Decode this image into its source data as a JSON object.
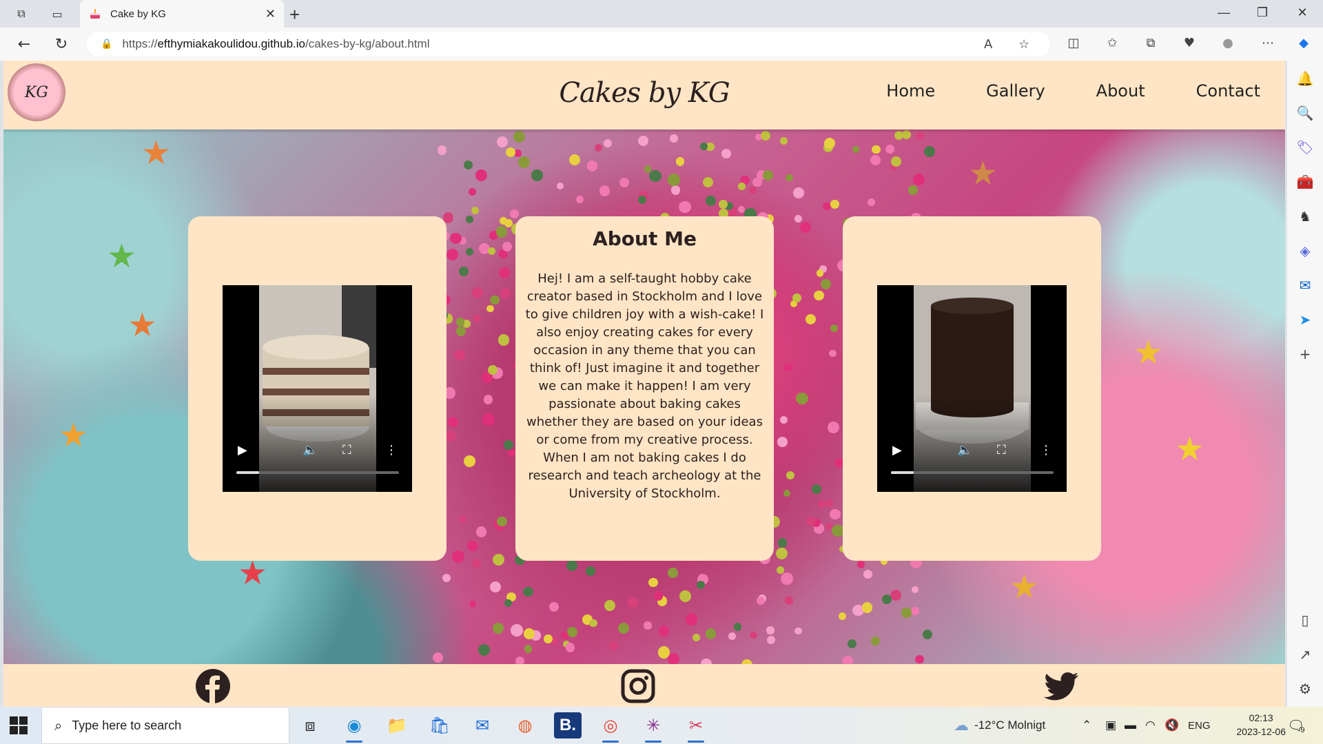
{
  "browser": {
    "tab_title": "Cake by KG",
    "url_prefix": "https://",
    "url_host": "efthymiakakoulidou.github.io",
    "url_path": "/cakes-by-kg/about.html"
  },
  "site": {
    "logo_text": "KG",
    "title": "Cakes by KG",
    "nav": [
      "Home",
      "Gallery",
      "About",
      "Contact"
    ]
  },
  "about": {
    "title": "About Me",
    "text": "Hej! I am a self-taught hobby cake creator based in Stockholm and I love to give children joy with a wish-cake! I also enjoy creating cakes for every occasion in any theme that you can think of! Just imagine it and together we can make it happen! I am very passionate about baking cakes whether they are based on your ideas or come from my creative process. When I am not baking cakes I do research and teach archeology at the University of Stockholm."
  },
  "videos": [
    {
      "icon": "naked-cake-video",
      "progress": 0.14
    },
    {
      "icon": "chocolate-cake-video",
      "progress": 0.14
    }
  ],
  "footer": {
    "social": [
      "facebook-icon",
      "instagram-icon",
      "twitter-icon"
    ]
  },
  "taskbar": {
    "search_placeholder": "Type here to search",
    "weather": "-12°C  Molnigt",
    "language": "ENG",
    "time": "02:13",
    "date": "2023-12-06",
    "notification_count": "9"
  },
  "colors": {
    "site_bg": "#ffe5c5",
    "logo_pink": "#ffc0cf",
    "text_dark": "#2d2020"
  }
}
